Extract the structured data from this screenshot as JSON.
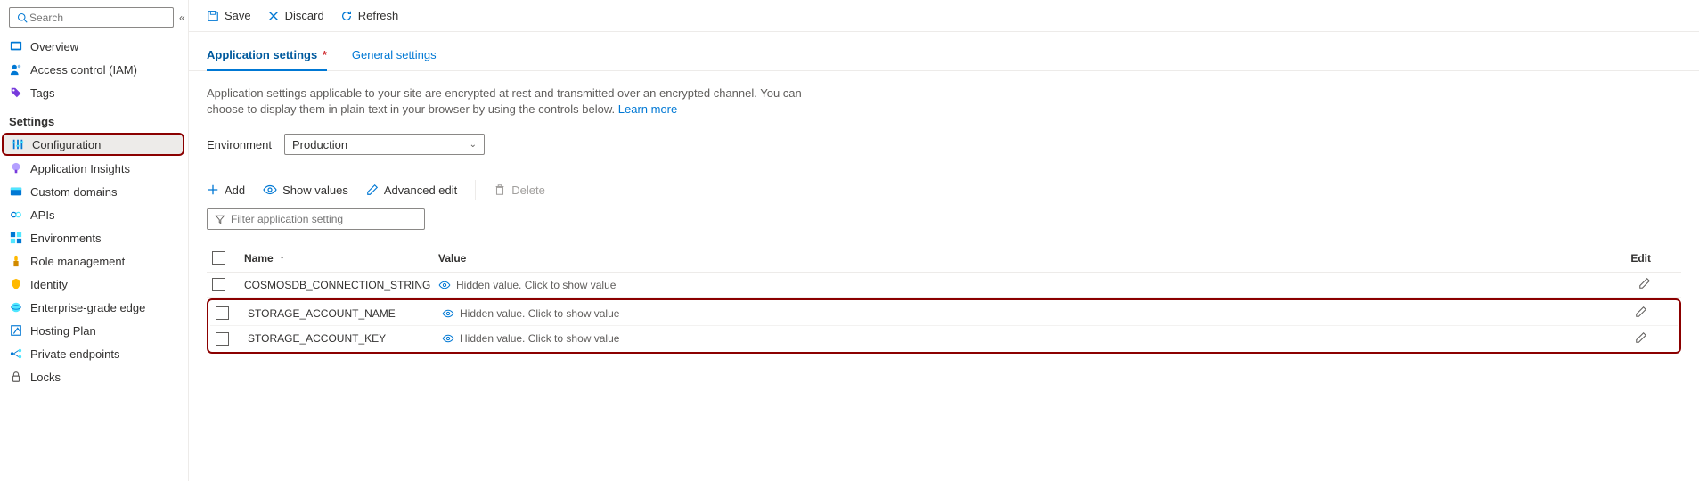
{
  "search": {
    "placeholder": "Search"
  },
  "sidebar": {
    "items": [
      {
        "icon": "overview-icon",
        "label": "Overview"
      },
      {
        "icon": "access-icon",
        "label": "Access control (IAM)"
      },
      {
        "icon": "tags-icon",
        "label": "Tags"
      }
    ],
    "section_label": "Settings",
    "settings_items": [
      {
        "icon": "config-icon",
        "label": "Configuration",
        "active": true
      },
      {
        "icon": "insights-icon",
        "label": "Application Insights"
      },
      {
        "icon": "domains-icon",
        "label": "Custom domains"
      },
      {
        "icon": "apis-icon",
        "label": "APIs"
      },
      {
        "icon": "env-icon",
        "label": "Environments"
      },
      {
        "icon": "role-icon",
        "label": "Role management"
      },
      {
        "icon": "identity-icon",
        "label": "Identity"
      },
      {
        "icon": "edge-icon",
        "label": "Enterprise-grade edge"
      },
      {
        "icon": "plan-icon",
        "label": "Hosting Plan"
      },
      {
        "icon": "endpoints-icon",
        "label": "Private endpoints"
      },
      {
        "icon": "locks-icon",
        "label": "Locks"
      }
    ]
  },
  "toolbar": {
    "save": "Save",
    "discard": "Discard",
    "refresh": "Refresh"
  },
  "tabs": {
    "app_settings": "Application settings",
    "general_settings": "General settings",
    "dirty_marker": "*"
  },
  "description": {
    "text": "Application settings applicable to your site are encrypted at rest and transmitted over an encrypted channel. You can choose to display them in plain text in your browser by using the controls below. ",
    "link": "Learn more"
  },
  "environment": {
    "label": "Environment",
    "selected": "Production"
  },
  "commands": {
    "add": "Add",
    "show_values": "Show values",
    "advanced_edit": "Advanced edit",
    "delete": "Delete"
  },
  "filter": {
    "placeholder": "Filter application setting"
  },
  "table": {
    "headers": {
      "name": "Name",
      "value": "Value",
      "edit": "Edit"
    },
    "hidden_text": "Hidden value. Click to show value",
    "rows": [
      {
        "name": "COSMOSDB_CONNECTION_STRING"
      },
      {
        "name": "STORAGE_ACCOUNT_NAME"
      },
      {
        "name": "STORAGE_ACCOUNT_KEY"
      }
    ]
  },
  "colors": {
    "accent": "#0078d4",
    "highlight_border": "#8b0000"
  }
}
